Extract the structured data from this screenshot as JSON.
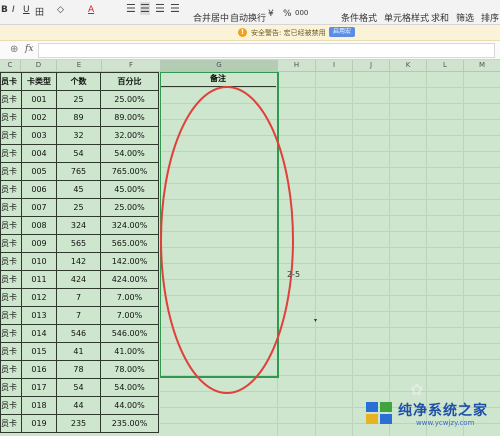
{
  "toolbar": {
    "font_buttons": [
      "B",
      "I",
      "U",
      "田",
      "◇",
      "A"
    ],
    "merge_label": "合并居中",
    "wrap_label": "自动换行",
    "currency_label": "¥",
    "percent_label": "%",
    "thousands_label": "000",
    "cond_format_label": "条件格式",
    "cell_style_label": "单元格样式",
    "sum_label": "求和",
    "filter_label": "筛选",
    "sort_label": "排序"
  },
  "security_bar": {
    "warning_text": "安全警告: 宏已经被禁用",
    "enable_label": "启用宏"
  },
  "formula_bar": {
    "fx_label": "fx",
    "value": ""
  },
  "columns": [
    {
      "label": "C"
    },
    {
      "label": "D"
    },
    {
      "label": "E"
    },
    {
      "label": "F"
    },
    {
      "label": "G",
      "selected": true
    },
    {
      "label": "H"
    },
    {
      "label": "I"
    },
    {
      "label": "J"
    },
    {
      "label": "K"
    },
    {
      "label": "L"
    },
    {
      "label": "M"
    }
  ],
  "table": {
    "headers": [
      "员卡",
      "卡类型",
      "个数",
      "百分比",
      "备注"
    ],
    "rows": [
      [
        "员卡",
        "001",
        "25",
        "25.00%"
      ],
      [
        "员卡",
        "002",
        "89",
        "89.00%"
      ],
      [
        "员卡",
        "003",
        "32",
        "32.00%"
      ],
      [
        "员卡",
        "004",
        "54",
        "54.00%"
      ],
      [
        "员卡",
        "005",
        "765",
        "765.00%"
      ],
      [
        "员卡",
        "006",
        "45",
        "45.00%"
      ],
      [
        "员卡",
        "007",
        "25",
        "25.00%"
      ],
      [
        "员卡",
        "008",
        "324",
        "324.00%"
      ],
      [
        "员卡",
        "009",
        "565",
        "565.00%"
      ],
      [
        "员卡",
        "010",
        "142",
        "142.00%"
      ],
      [
        "员卡",
        "011",
        "424",
        "424.00%"
      ],
      [
        "员卡",
        "012",
        "7",
        "7.00%"
      ],
      [
        "员卡",
        "013",
        "7",
        "7.00%"
      ],
      [
        "员卡",
        "014",
        "546",
        "546.00%"
      ],
      [
        "员卡",
        "015",
        "41",
        "41.00%"
      ],
      [
        "员卡",
        "016",
        "78",
        "78.00%"
      ],
      [
        "员卡",
        "017",
        "54",
        "54.00%"
      ],
      [
        "员卡",
        "018",
        "44",
        "44.00%"
      ],
      [
        "员卡",
        "019",
        "235",
        "235.00%"
      ]
    ]
  },
  "floating_text": "2-5",
  "watermark": {
    "name": "纯净系统之家",
    "url": "www.ycwjzy.com"
  },
  "colors": {
    "sheet_bg": "#cde6cd",
    "oval": "#e0403a",
    "selection": "#2f9a4f"
  }
}
